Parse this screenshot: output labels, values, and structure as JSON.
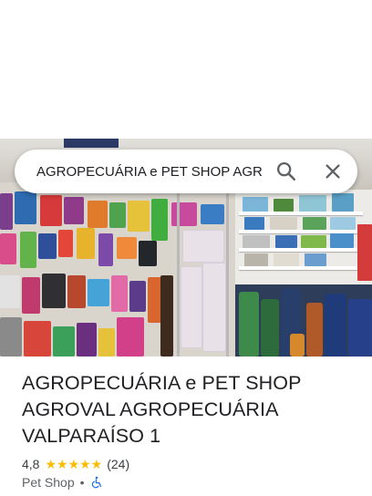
{
  "search": {
    "query": "AGROPECUÁRIA e PET SHOP AGROVAL AGROPECUÁRIA VALPARAÍSO 1"
  },
  "place": {
    "title": "AGROPECUÁRIA e PET SHOP AGROVAL AGROPECUÁRIA VALPARAÍSO 1",
    "rating": "4,8",
    "stars": "★★★★★",
    "star_count": 5,
    "review_count": "(24)",
    "category": "Pet Shop",
    "separator": "•"
  },
  "icons": {
    "search": "search-icon",
    "close": "close-icon",
    "accessibility": "wheelchair-accessible-icon"
  },
  "colors": {
    "star": "#fbbc04",
    "accessibility": "#1a73e8",
    "text_primary": "#202124",
    "text_secondary": "#5f6368"
  }
}
